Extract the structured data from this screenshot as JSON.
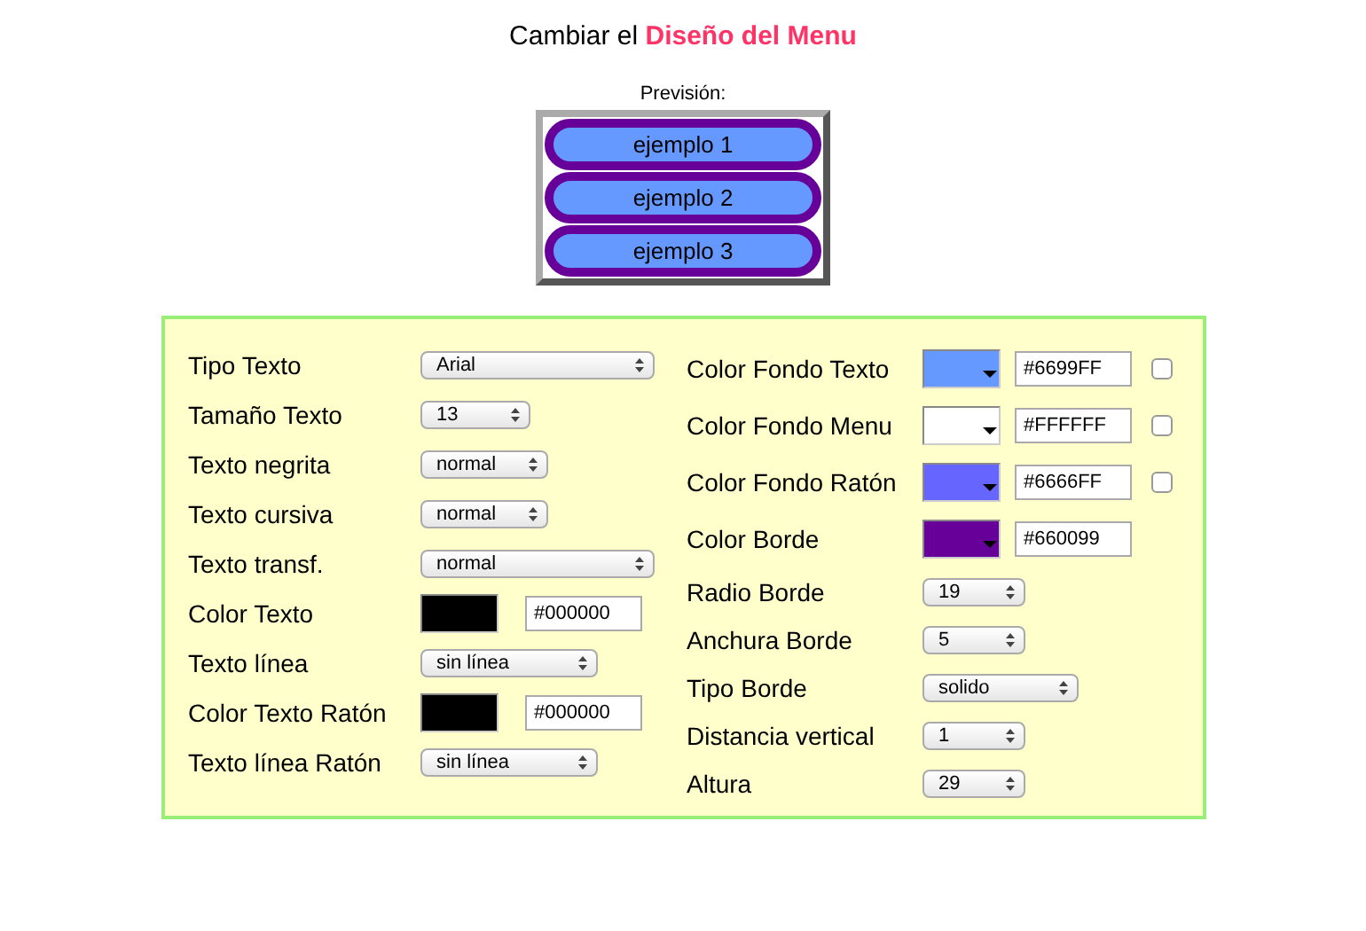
{
  "title": "Cambiar el **Diseño del Menu**",
  "preview": {
    "label": "Previsión:",
    "items": [
      "ejemplo 1",
      "ejemplo 2",
      "ejemplo 3"
    ]
  },
  "left": [
    {
      "kind": "select",
      "label": "Tipo Texto",
      "value": "Arial"
    },
    {
      "kind": "select",
      "label": "Tamaño Texto",
      "value": "13"
    },
    {
      "kind": "select",
      "label": "Texto negrita",
      "value": "normal"
    },
    {
      "kind": "select",
      "label": "Texto cursiva",
      "value": "normal"
    },
    {
      "kind": "select",
      "label": "Texto transf.",
      "value": "normal"
    },
    {
      "kind": "color",
      "label": "Color Texto",
      "color": "#000000",
      "value": "#000000"
    },
    {
      "kind": "select",
      "label": "Texto línea",
      "value": "sin línea"
    },
    {
      "kind": "color",
      "label": "Color Texto Ratón",
      "color": "#000000",
      "value": "#000000"
    },
    {
      "kind": "select",
      "label": "Texto línea Ratón",
      "value": "sin línea"
    }
  ],
  "right": [
    {
      "kind": "color",
      "label": "Color Fondo Texto",
      "color": "#6699ff",
      "value": "#6699FF",
      "checked": false
    },
    {
      "kind": "color",
      "label": "Color Fondo Menu",
      "color": "#ffffff",
      "value": "#FFFFFF",
      "checked": false
    },
    {
      "kind": "color",
      "label": "Color Fondo Ratón",
      "color": "#6666ff",
      "value": "#6666FF",
      "checked": false
    },
    {
      "kind": "color",
      "label": "Color Borde",
      "color": "#660099",
      "value": "#660099"
    },
    {
      "kind": "select",
      "label": "Radio Borde",
      "value": "19"
    },
    {
      "kind": "select",
      "label": "Anchura Borde",
      "value": "5"
    },
    {
      "kind": "select",
      "label": "Tipo Borde",
      "value": "solido"
    },
    {
      "kind": "select",
      "label": "Distancia vertical",
      "value": "1"
    },
    {
      "kind": "select",
      "label": "Altura",
      "value": "29"
    }
  ]
}
